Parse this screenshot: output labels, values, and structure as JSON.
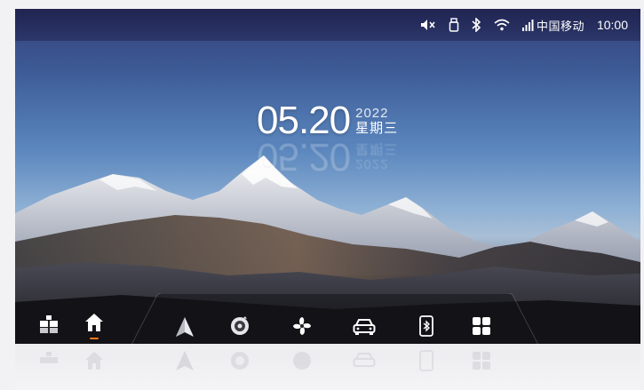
{
  "status_bar": {
    "icons": [
      "mute-icon",
      "usb-icon",
      "bluetooth-icon",
      "wifi-icon",
      "signal-icon"
    ],
    "carrier": "中国移动",
    "time": "10:00"
  },
  "date_widget": {
    "date": "05.20",
    "year": "2022",
    "weekday": "星期三"
  },
  "dock": {
    "items": [
      {
        "name": "apps-icon"
      },
      {
        "name": "home-icon",
        "active": true
      },
      {
        "name": "navigation-icon"
      },
      {
        "name": "music-icon"
      },
      {
        "name": "fan-icon"
      },
      {
        "name": "car-icon"
      },
      {
        "name": "phone-bluetooth-icon"
      },
      {
        "name": "grid-menu-icon"
      }
    ],
    "active_color": "#ff7a1a"
  }
}
